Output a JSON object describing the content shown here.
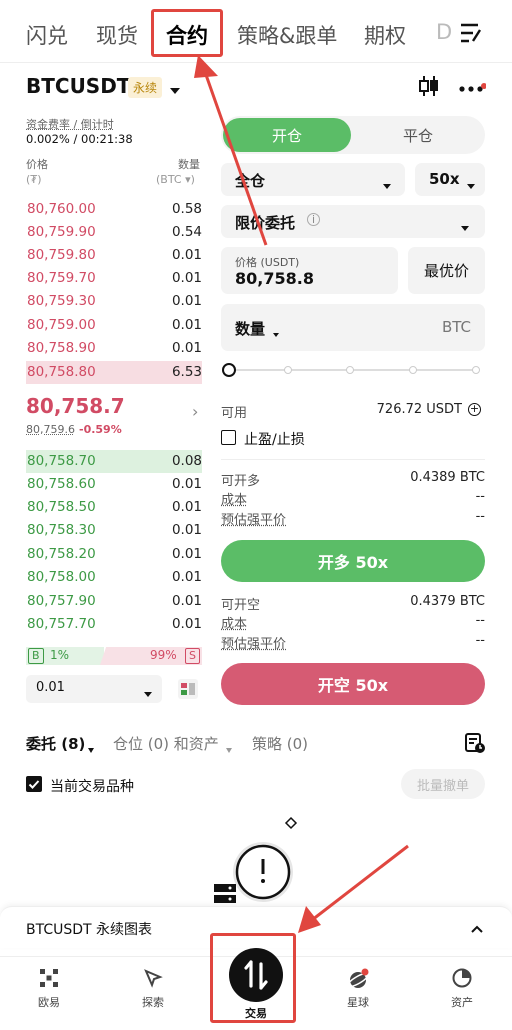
{
  "tabs": [
    "闪兑",
    "现货",
    "合约",
    "策略&跟单",
    "期权",
    "D"
  ],
  "header": {
    "symbol": "BTCUSDT",
    "contract_type": "永续"
  },
  "funding": {
    "label": "资金费率 / 倒计时",
    "value": "0.002% / 00:21:38"
  },
  "orderbook": {
    "price_label": "价格",
    "price_unit": "(₮)",
    "qty_label": "数量",
    "qty_unit": "(BTC ▾)",
    "asks": [
      {
        "price": "80,760.00",
        "qty": "0.58"
      },
      {
        "price": "80,759.90",
        "qty": "0.54"
      },
      {
        "price": "80,759.80",
        "qty": "0.01"
      },
      {
        "price": "80,759.70",
        "qty": "0.01"
      },
      {
        "price": "80,759.30",
        "qty": "0.01"
      },
      {
        "price": "80,759.00",
        "qty": "0.01"
      },
      {
        "price": "80,758.90",
        "qty": "0.01"
      },
      {
        "price": "80,758.80",
        "qty": "6.53"
      }
    ],
    "last_price": "80,758.7",
    "mark_price": "80,759.6",
    "change": "-0.59%",
    "bids": [
      {
        "price": "80,758.70",
        "qty": "0.08"
      },
      {
        "price": "80,758.60",
        "qty": "0.01"
      },
      {
        "price": "80,758.50",
        "qty": "0.01"
      },
      {
        "price": "80,758.30",
        "qty": "0.01"
      },
      {
        "price": "80,758.20",
        "qty": "0.01"
      },
      {
        "price": "80,758.00",
        "qty": "0.01"
      },
      {
        "price": "80,757.90",
        "qty": "0.01"
      },
      {
        "price": "80,757.70",
        "qty": "0.01"
      }
    ],
    "buy_letter": "B",
    "buy_pct": "1%",
    "sell_pct": "99%",
    "sell_letter": "S",
    "step": "0.01"
  },
  "form": {
    "open_tab": "开仓",
    "close_tab": "平仓",
    "margin_mode": "全仓",
    "leverage": "50x",
    "order_type": "限价委托",
    "price_label": "价格 (USDT)",
    "price_value": "80,758.8",
    "best_price": "最优价",
    "qty_label": "数量",
    "qty_unit": "BTC",
    "available_label": "可用",
    "available_value": "726.72 USDT",
    "tpsl_label": "止盈/止损",
    "long_max_label": "可开多",
    "long_max_value": "0.4389 BTC",
    "cost_label": "成本",
    "cost_value": "--",
    "liq_label": "预估强平价",
    "liq_value": "--",
    "long_button": "开多 50x",
    "short_max_label": "可开空",
    "short_max_value": "0.4379 BTC",
    "short_cost_label": "成本",
    "short_cost_value": "--",
    "short_liq_label": "预估强平价",
    "short_liq_value": "--",
    "short_button": "开空 50x"
  },
  "orders_tabs": {
    "entrusts": "委托 (8)",
    "positions": "仓位 (0) 和资产",
    "strategy": "策略 (0)"
  },
  "current_symbol": "当前交易品种",
  "batch_cancel": "批量撤单",
  "chart_bar": "BTCUSDT 永续图表",
  "nav": [
    "欧易",
    "探索",
    "交易",
    "星球",
    "资产"
  ],
  "colors": {
    "buy": "#5bbd67",
    "sell": "#d65b73",
    "annotation": "#e0463f"
  }
}
